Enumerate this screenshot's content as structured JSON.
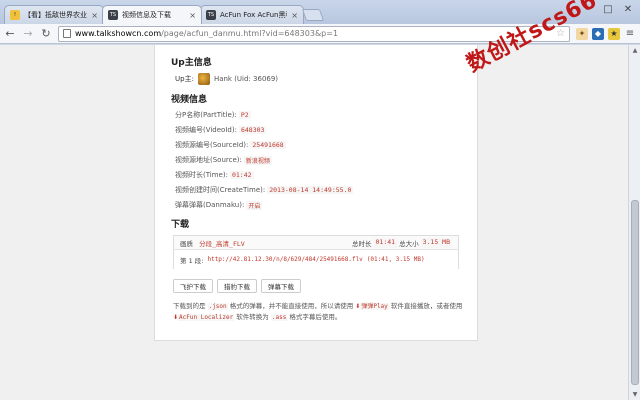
{
  "tabs": [
    {
      "label": "【看】抵敌世界农业的先",
      "icon": "warning-icon",
      "close": "×"
    },
    {
      "label": "视频信息及下载",
      "icon": "ts-icon",
      "close": "×"
    },
    {
      "label": "AcFun Fox AcFun黑科技",
      "icon": "ts-icon",
      "close": "×"
    }
  ],
  "window_controls": {
    "minimize": "–",
    "restore": "□",
    "close": "✕"
  },
  "toolbar": {
    "url_host": "www.talkshowcn.com",
    "url_path": "/page/acfun_danmu.html?vid=648303&p=1"
  },
  "up_section": {
    "title": "Up主信息",
    "label": "Up主:",
    "name": "Hank (Uid: 36069)"
  },
  "video_section": {
    "title": "视频信息",
    "rows": [
      {
        "label": "分P名称(PartTitle):",
        "value": "P2"
      },
      {
        "label": "视频编号(VideoId):",
        "value": "648303"
      },
      {
        "label": "视频源编号(SourceId):",
        "value": "25491668"
      },
      {
        "label": "视频源地址(Source):",
        "value": "新浪视频"
      },
      {
        "label": "视频时长(Time):",
        "value": "01:42"
      },
      {
        "label": "视频创建时间(CreateTime):",
        "value": "2013-08-14 14:49:55.0"
      },
      {
        "label": "弹幕弹幕(Danmaku):",
        "value": "开启"
      }
    ]
  },
  "download": {
    "title": "下载",
    "quality_label": "画质",
    "quality_value": "分段_高清_FLV",
    "total_label": "总时长",
    "total_time": "01:41",
    "size_label": "总大小",
    "total_size": "3.15 MB",
    "segment_label": "第 1 段:",
    "segment_url": "http://42.81.12.30/n/8/629/484/25491668.flv",
    "segment_meta": "(01:41, 3.15 MB)",
    "buttons": [
      "飞护下载",
      "猎豹下载",
      "弹幕下载"
    ],
    "note_1": "下载到的是",
    "note_json": ".json",
    "note_2": "格式的弹幕，并不能直接使用，所以请使用",
    "note_player": "弹弹Play",
    "note_3": "软件直接播放，或者使用",
    "note_localizer": "AcFun Localizer",
    "note_4": "软件转换为",
    "note_ass": ".ass",
    "note_5": "格式字幕后使用。"
  },
  "watermark": "数创社scs66"
}
